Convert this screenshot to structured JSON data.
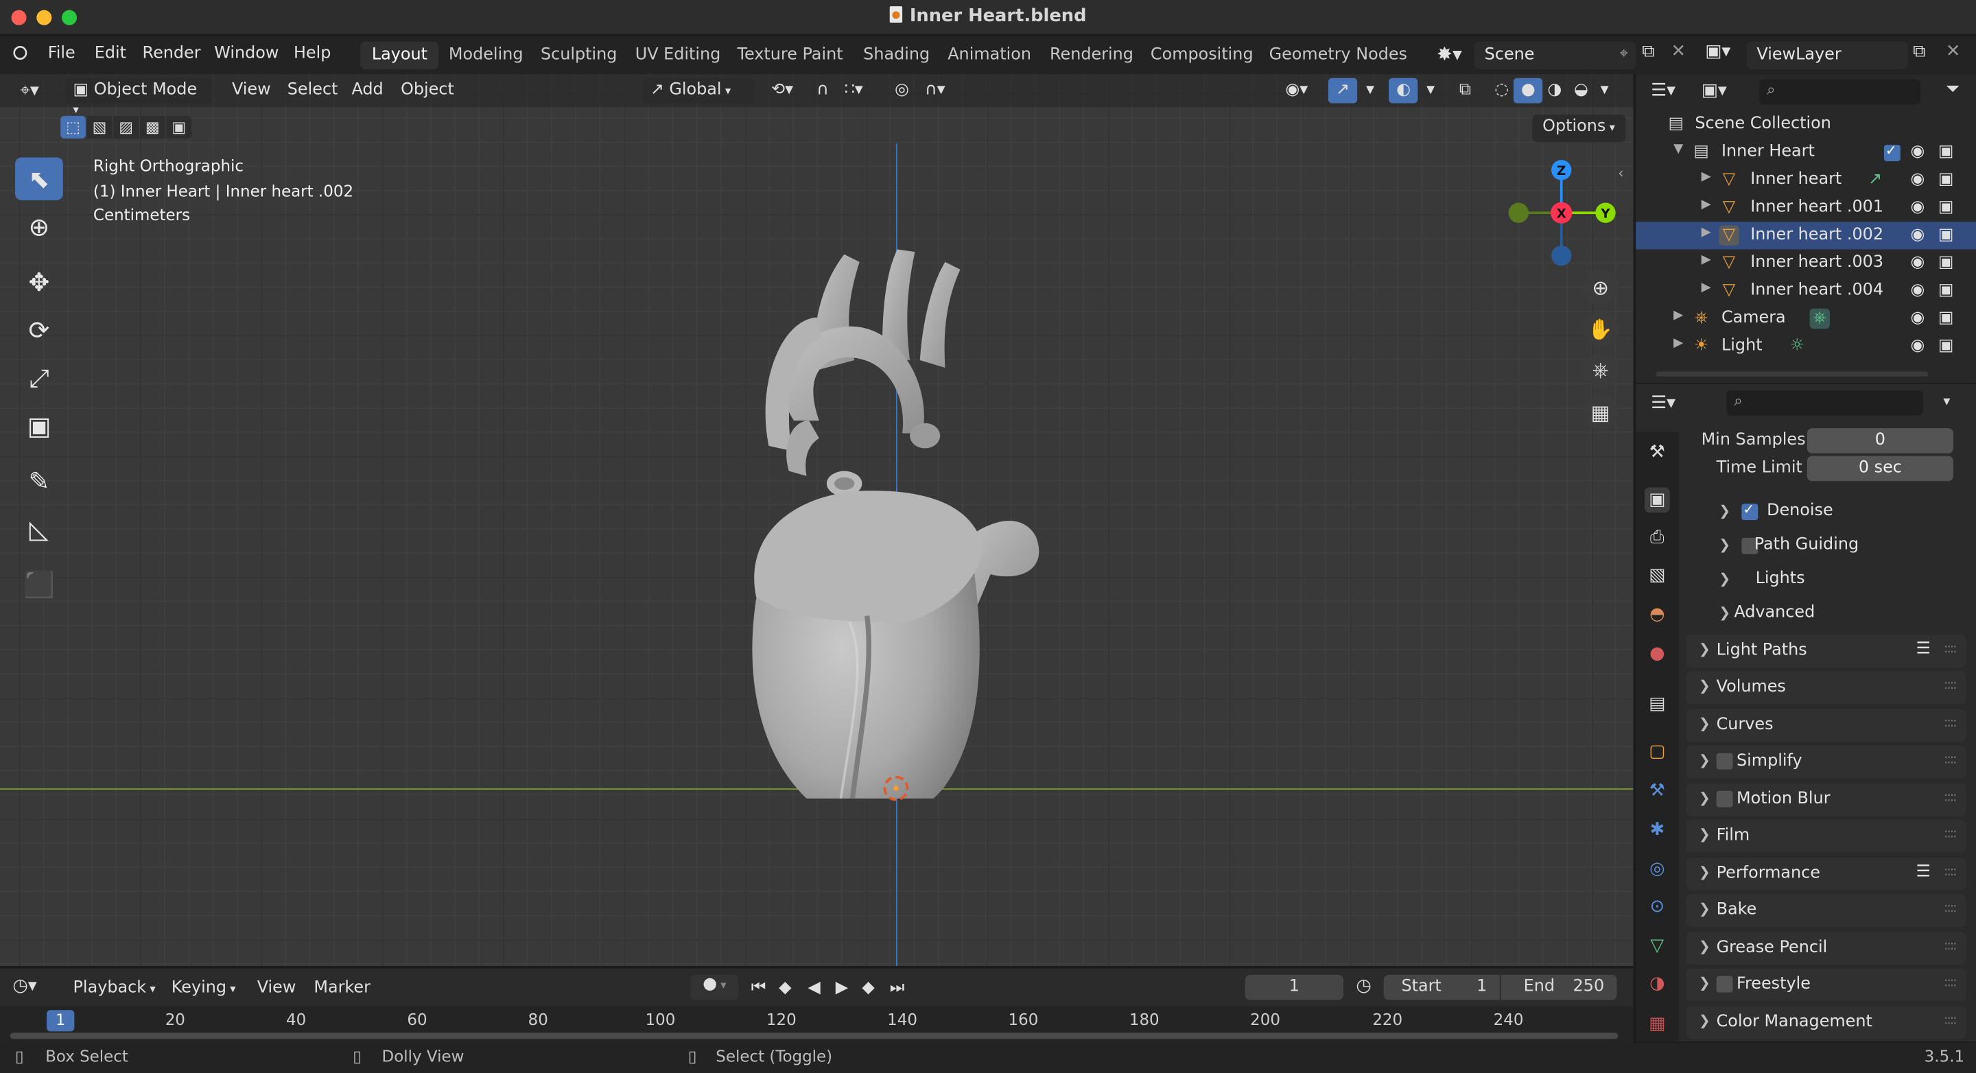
{
  "window": {
    "title": "Inner Heart.blend"
  },
  "menubar": {
    "items": [
      "File",
      "Edit",
      "Render",
      "Window",
      "Help"
    ],
    "workspaces": [
      "Layout",
      "Modeling",
      "Sculpting",
      "UV Editing",
      "Texture Paint",
      "Shading",
      "Animation",
      "Rendering",
      "Compositing",
      "Geometry Nodes"
    ],
    "active_workspace": "Layout",
    "scene": "Scene",
    "view_layer": "ViewLayer"
  },
  "viewport": {
    "mode": "Object Mode",
    "menus": [
      "View",
      "Select",
      "Add",
      "Object"
    ],
    "orientation": "Global",
    "options_label": "Options",
    "overlay": {
      "view_name": "Right Orthographic",
      "object_info": "(1) Inner Heart | Inner heart .002",
      "units": "Centimeters"
    },
    "gizmo_axes": [
      "Z",
      "X",
      "Y"
    ],
    "colors": {
      "x_axis": "#ff3352",
      "y_axis": "#8bdc00",
      "z_axis": "#2890ff",
      "grid_floor": "#7a9a2a",
      "grid_vertical": "#3a76c4"
    }
  },
  "outliner": {
    "root": "Scene Collection",
    "items": [
      {
        "label": "Inner Heart",
        "type": "collection"
      },
      {
        "label": "Inner heart",
        "type": "mesh"
      },
      {
        "label": "Inner heart .001",
        "type": "mesh"
      },
      {
        "label": "Inner heart .002",
        "type": "mesh",
        "selected": true
      },
      {
        "label": "Inner heart .003",
        "type": "mesh"
      },
      {
        "label": "Inner heart .004",
        "type": "mesh"
      },
      {
        "label": "Camera",
        "type": "camera"
      },
      {
        "label": "Light",
        "type": "light"
      }
    ]
  },
  "properties": {
    "min_samples_label": "Min Samples",
    "min_samples_value": "0",
    "time_limit_label": "Time Limit",
    "time_limit_value": "0 sec",
    "sub_panels": [
      {
        "label": "Denoise",
        "checkbox": true,
        "checked": true
      },
      {
        "label": "Path Guiding",
        "checkbox": true,
        "checked": false
      },
      {
        "label": "Lights",
        "checkbox": false
      },
      {
        "label": "Advanced",
        "checkbox": false
      }
    ],
    "panels": [
      {
        "label": "Light Paths",
        "checkbox": false
      },
      {
        "label": "Volumes",
        "checkbox": false
      },
      {
        "label": "Curves",
        "checkbox": false
      },
      {
        "label": "Simplify",
        "checkbox": true
      },
      {
        "label": "Motion Blur",
        "checkbox": true
      },
      {
        "label": "Film",
        "checkbox": false
      },
      {
        "label": "Performance",
        "checkbox": false
      },
      {
        "label": "Bake",
        "checkbox": false
      },
      {
        "label": "Grease Pencil",
        "checkbox": false
      },
      {
        "label": "Freestyle",
        "checkbox": true
      },
      {
        "label": "Color Management",
        "checkbox": false
      }
    ]
  },
  "timeline": {
    "menus": [
      "Playback",
      "Keying",
      "View",
      "Marker"
    ],
    "current_frame": "1",
    "start_label": "Start",
    "start_value": "1",
    "end_label": "End",
    "end_value": "250",
    "ticks": [
      "20",
      "40",
      "60",
      "80",
      "100",
      "120",
      "140",
      "160",
      "180",
      "200",
      "220",
      "240"
    ],
    "playhead_frame": "1"
  },
  "statusbar": {
    "left": "Box Select",
    "middle": "Dolly View",
    "right": "Select (Toggle)",
    "version": "3.5.1"
  }
}
